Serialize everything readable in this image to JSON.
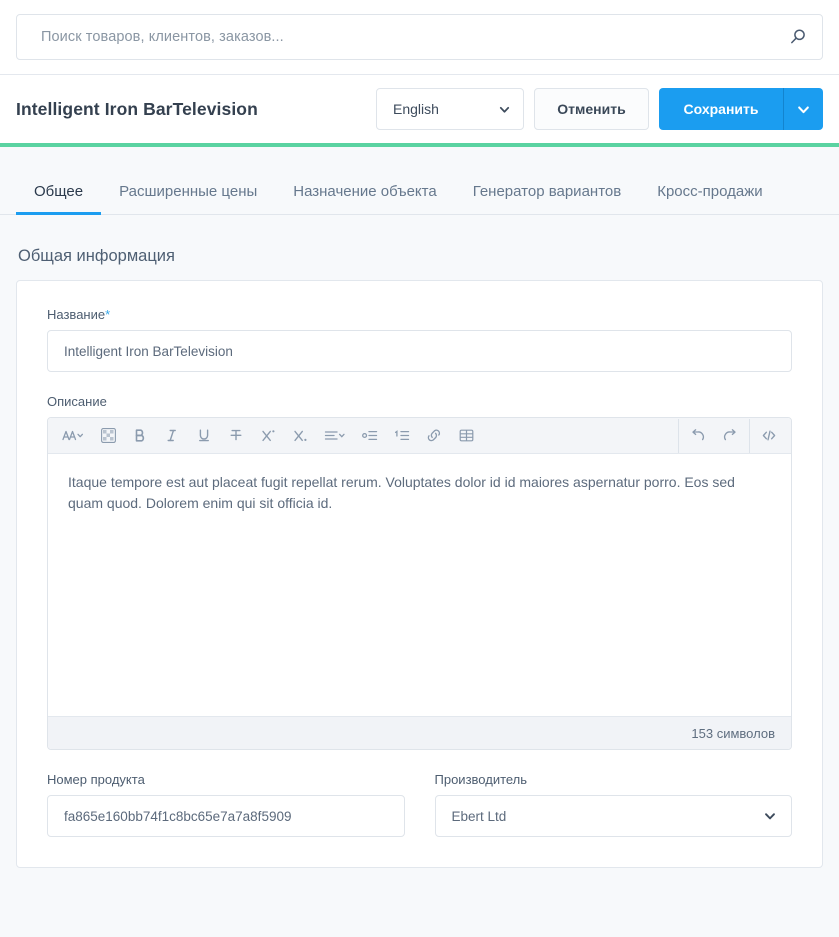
{
  "search": {
    "placeholder": "Поиск товаров, клиентов, заказов...",
    "icon": "search-icon"
  },
  "header": {
    "title": "Intelligent Iron BarTelevision",
    "language": "English",
    "cancel_label": "Отменить",
    "save_label": "Сохранить",
    "accent_color": "#1b9df0",
    "rule_color": "#5ad3a1"
  },
  "tabs": [
    {
      "label": "Общее",
      "active": true
    },
    {
      "label": "Расширенные цены",
      "active": false
    },
    {
      "label": "Назначение объекта",
      "active": false
    },
    {
      "label": "Генератор вариантов",
      "active": false
    },
    {
      "label": "Кросс-продажи",
      "active": false
    }
  ],
  "section": {
    "title": "Общая информация"
  },
  "form": {
    "name_label": "Название",
    "name_required_mark": "*",
    "name_value": "Intelligent Iron BarTelevision",
    "description_label": "Описание",
    "description_value": "Itaque tempore est aut placeat fugit repellat rerum. Voluptates dolor id id maiores aspernatur porro. Eos sed quam quod. Dolorem enim qui sit officia id.",
    "char_count": "153 символов",
    "product_number_label": "Номер продукта",
    "product_number_value": "fa865e160bb74f1c8bc65e7a7a8f5909",
    "manufacturer_label": "Производитель",
    "manufacturer_value": "Ebert Ltd"
  },
  "editor_toolbar": {
    "left": [
      "font-format-icon",
      "text-color-icon",
      "bold-icon",
      "italic-icon",
      "underline-icon",
      "strikethrough-icon",
      "superscript-icon",
      "subscript-icon",
      "align-icon",
      "bullet-list-icon",
      "numbered-list-icon",
      "link-icon",
      "table-icon"
    ],
    "right": [
      "undo-icon",
      "redo-icon",
      "code-view-icon"
    ]
  }
}
